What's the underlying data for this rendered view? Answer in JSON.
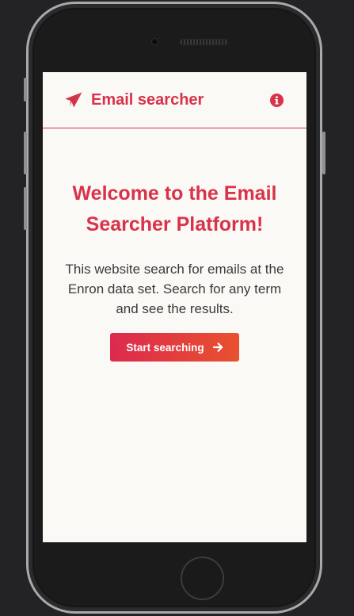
{
  "header": {
    "brand_icon": "paper-plane-icon",
    "brand_title": "Email searcher",
    "info_icon": "info-circle-icon"
  },
  "hero": {
    "title_line1": "Welcome to the Email",
    "title_line2": "Searcher Platform!",
    "description": "This website search for emails at the Enron data set. Search for any term and see the results.",
    "cta_label": "Start searching",
    "cta_icon": "arrow-right-icon"
  },
  "colors": {
    "accent": "#d9324a",
    "gradient_start": "#dc2a4e",
    "gradient_end": "#e8512f",
    "screen_background": "#faf9f5",
    "page_background": "#232325"
  }
}
